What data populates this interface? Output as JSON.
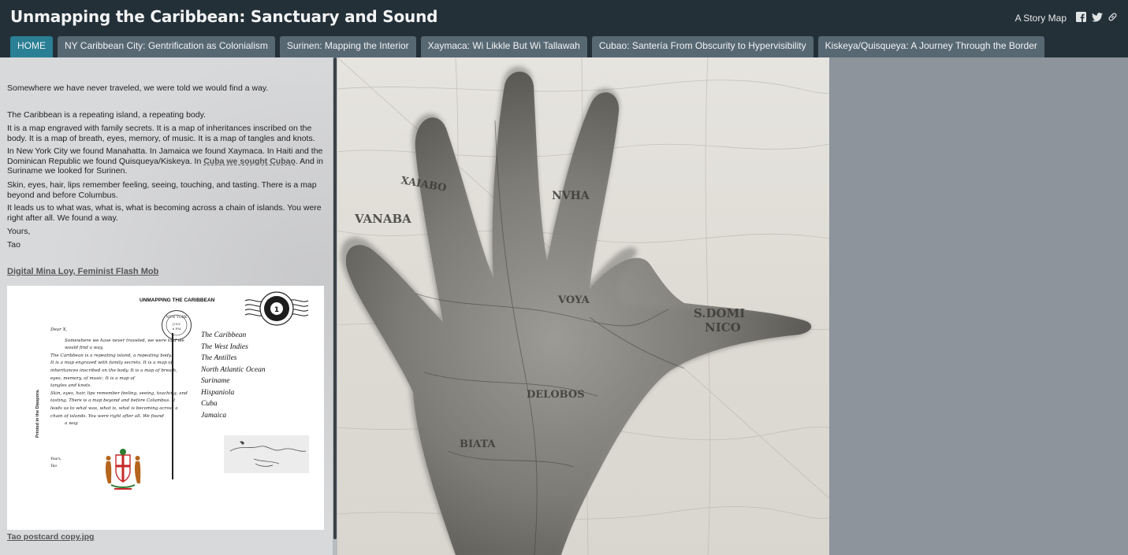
{
  "header": {
    "title": "Unmapping the Caribbean: Sanctuary and Sound",
    "story_map_label": "A Story Map",
    "share_icons": [
      "facebook-icon",
      "twitter-icon",
      "link-icon"
    ]
  },
  "tabs": [
    {
      "label": "HOME",
      "active": true
    },
    {
      "label": "NY Caribbean City: Gentrification as Colonialism",
      "active": false
    },
    {
      "label": "Surinen: Mapping the Interior",
      "active": false
    },
    {
      "label": "Xaymaca: Wi Likkle But Wi Tallawah",
      "active": false
    },
    {
      "label": "Cubao: Santería From Obscurity to Hypervisibility",
      "active": false
    },
    {
      "label": "Kiskeya/Quisqueya: A Journey Through the Border",
      "active": false
    }
  ],
  "panel": {
    "intro": "Somewhere we have never traveled, we were told we would find a way.",
    "p1": "The Caribbean is a repeating island, a repeating body.",
    "p2": "It is a map engraved with family secrets. It is a map of inheritances inscribed on the body. It is a map of breath, eyes, memory, of music. It is a map of tangles and knots.",
    "p3_before": "In New York City we found Manahatta. In Jamaica we found Xaymaca. In Haiti and the Dominican Republic we found Quisqueya/Kiskeya. In ",
    "p3_link": "Cuba we sought Cubao",
    "p3_after": ". And in Suriname we looked for Surinen.",
    "p4": "Skin, eyes, hair, lips remember feeling, seeing, touching, and tasting. There is a map beyond and before Columbus.",
    "p5": "It leads us to what was, what is, what is becoming across a chain of islands. You were right after all. We found a way.",
    "closing": "Yours,",
    "signature": "Tao",
    "heading_link": "Digital Mina Loy, Feminist Flash Mob",
    "image_caption": "Tao postcard copy.jpg"
  },
  "postcard": {
    "title": "UNMAPPING THE CARIBBEAN",
    "postmark": "NEW YORK",
    "salutation": "Dear X,",
    "letter_lines": [
      "Somewhere we have never traveled, we were told we",
      "would find a way.",
      "The Caribbean is a repeating island, a repeating body.",
      "It is a map engraved with family secrets. It is a map of",
      "inheritances inscribed on the body. It is a map of breath,",
      "eyes, memory, of music. It is a map of",
      "tangles and knots.",
      "Skin, eyes, hair, lips remember feeling, seeing, touching, and",
      "tasting. There is a map beyond and before Columbus. It",
      "leads us to what was, what is, what is becoming across a",
      "chain of islands. You were right after all. We found",
      "a way."
    ],
    "closing": "Yours,",
    "signature": "Tao",
    "vertical_text": "Printed in the Diaspora.",
    "places": [
      "The Caribbean",
      "The West Indies",
      "The Antilles",
      "North Atlantic Ocean",
      "Suriname",
      "Hispaniola",
      "Cuba",
      "Jamaica"
    ]
  },
  "map_labels": [
    "XAIABO",
    "NVHA",
    "VANABA",
    "VOYA",
    "S.DOMI",
    "NICO",
    "DELOBOS",
    "BIATA"
  ]
}
